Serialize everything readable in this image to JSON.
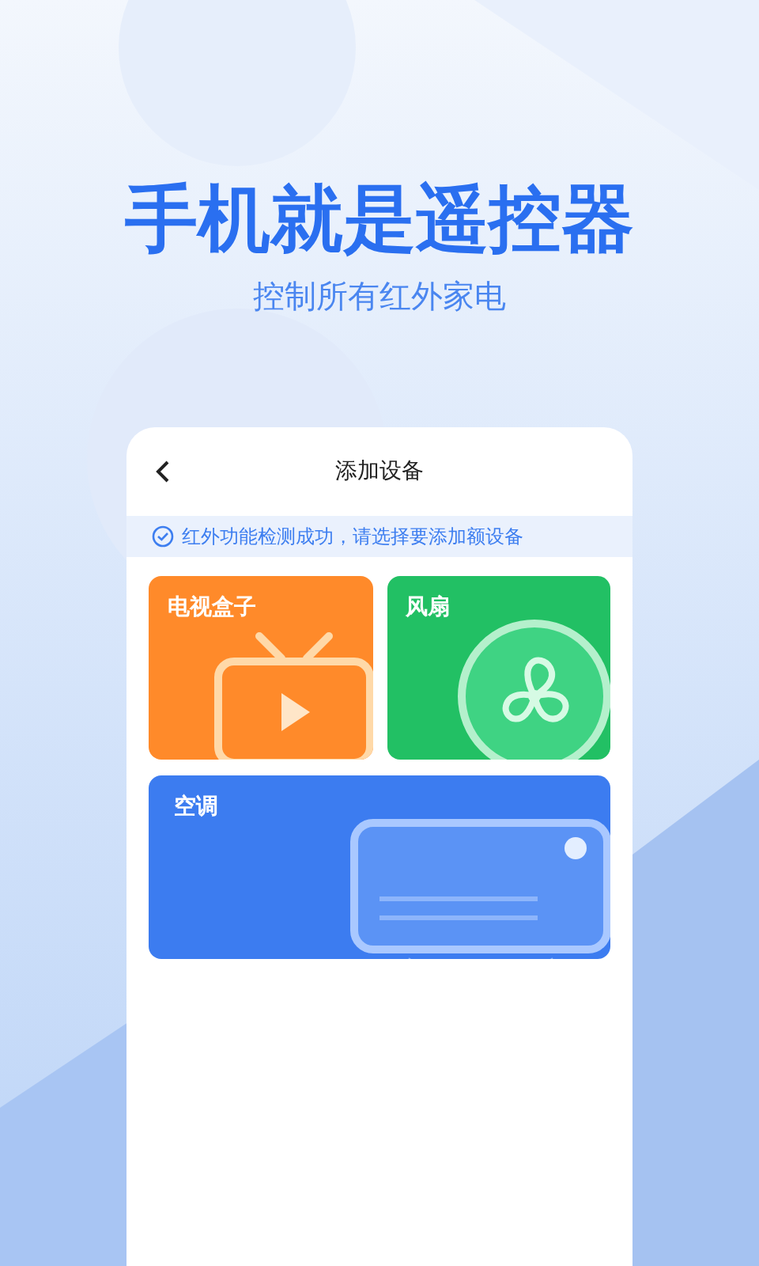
{
  "headline": "手机就是遥控器",
  "subheadline": "控制所有红外家电",
  "screen": {
    "title": "添加设备",
    "notice": "红外功能检测成功，请选择要添加额设备",
    "devices": [
      {
        "kind": "tv",
        "label": "电视盒子",
        "color": "#ff8a2a"
      },
      {
        "kind": "fan",
        "label": "风扇",
        "color": "#22c064"
      },
      {
        "kind": "ac",
        "label": "空调",
        "color": "#3c7cf0"
      }
    ]
  }
}
